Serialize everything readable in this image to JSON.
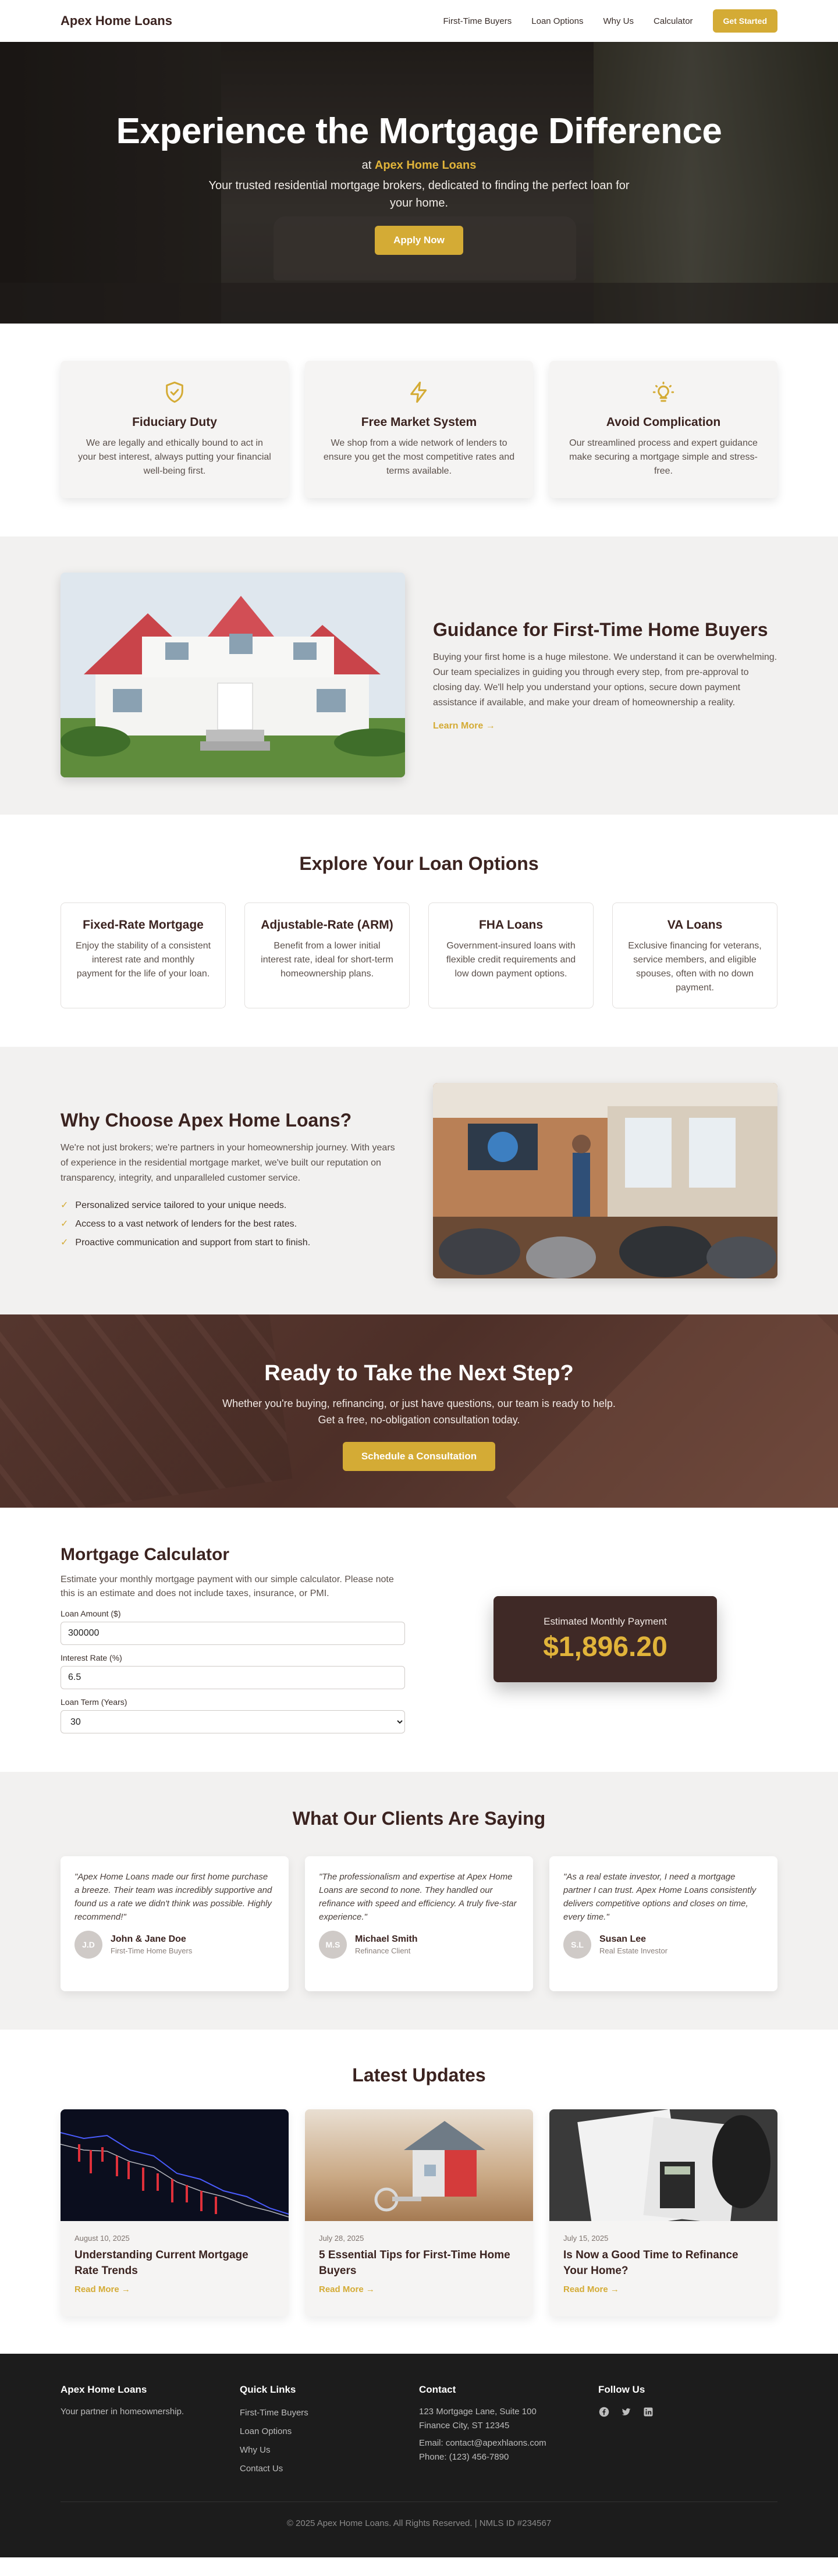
{
  "nav": {
    "brand": "Apex Home Loans",
    "links": [
      "First-Time Buyers",
      "Loan Options",
      "Why Us",
      "Calculator"
    ],
    "cta": "Get Started"
  },
  "hero": {
    "title": "Experience the Mortgage Difference",
    "at": "at",
    "brand": "Apex Home Loans",
    "subtitle": "Your trusted residential mortgage brokers, dedicated to finding the perfect loan for your home.",
    "cta": "Apply Now"
  },
  "features": [
    {
      "icon": "shield-check-icon",
      "title": "Fiduciary Duty",
      "text": "We are legally and ethically bound to act in your best interest, always putting your financial well-being first."
    },
    {
      "icon": "lightning-bolt-icon",
      "title": "Free Market System",
      "text": "We shop from a wide network of lenders to ensure you get the most competitive rates and terms available."
    },
    {
      "icon": "lightbulb-icon",
      "title": "Avoid Complication",
      "text": "Our streamlined process and expert guidance make securing a mortgage simple and stress-free."
    }
  ],
  "guidance": {
    "title": "Guidance for First-Time Home Buyers",
    "text": "Buying your first home is a huge milestone. We understand it can be overwhelming. Our team specializes in guiding you through every step, from pre-approval to closing day. We'll help you understand your options, secure down payment assistance if available, and make your dream of homeownership a reality.",
    "link": "Learn More →"
  },
  "loans": {
    "title": "Explore Your Loan Options",
    "items": [
      {
        "title": "Fixed-Rate Mortgage",
        "text": "Enjoy the stability of a consistent interest rate and monthly payment for the life of your loan."
      },
      {
        "title": "Adjustable-Rate (ARM)",
        "text": "Benefit from a lower initial interest rate, ideal for short-term homeownership plans."
      },
      {
        "title": "FHA Loans",
        "text": "Government-insured loans with flexible credit requirements and low down payment options."
      },
      {
        "title": "VA Loans",
        "text": "Exclusive financing for veterans, service members, and eligible spouses, often with no down payment."
      }
    ]
  },
  "why": {
    "title": "Why Choose Apex Home Loans?",
    "text": "We're not just brokers; we're partners in your homeownership journey. With years of experience in the residential mortgage market, we've built our reputation on transparency, integrity, and unparalleled customer service.",
    "points": [
      "Personalized service tailored to your unique needs.",
      "Access to a vast network of lenders for the best rates.",
      "Proactive communication and support from start to finish."
    ]
  },
  "cta": {
    "title": "Ready to Take the Next Step?",
    "text": "Whether you're buying, refinancing, or just have questions, our team is ready to help. Get a free, no-obligation consultation today.",
    "button": "Schedule a Consultation"
  },
  "calculator": {
    "title": "Mortgage Calculator",
    "desc": "Estimate your monthly mortgage payment with our simple calculator. Please note this is an estimate and does not include taxes, insurance, or PMI.",
    "amount_label": "Loan Amount ($)",
    "amount_value": "300000",
    "rate_label": "Interest Rate (%)",
    "rate_value": "6.5",
    "term_label": "Loan Term (Years)",
    "term_value": "30",
    "result_label": "Estimated Monthly Payment",
    "result_value": "$1,896.20"
  },
  "testimonials": {
    "title": "What Our Clients Are Saying",
    "items": [
      {
        "quote": "\"Apex Home Loans made our first home purchase a breeze. Their team was incredibly supportive and found us a rate we didn't think was possible. Highly recommend!\"",
        "initials": "J.D",
        "name": "John & Jane Doe",
        "role": "First-Time Home Buyers"
      },
      {
        "quote": "\"The professionalism and expertise at Apex Home Loans are second to none. They handled our refinance with speed and efficiency. A truly five-star experience.\"",
        "initials": "M.S",
        "name": "Michael Smith",
        "role": "Refinance Client"
      },
      {
        "quote": "\"As a real estate investor, I need a mortgage partner I can trust. Apex Home Loans consistently delivers competitive options and closes on time, every time.\"",
        "initials": "S.L",
        "name": "Susan Lee",
        "role": "Real Estate Investor"
      }
    ]
  },
  "blog": {
    "title": "Latest Updates",
    "posts": [
      {
        "date": "August 10, 2025",
        "title": "Understanding Current Mortgage Rate Trends",
        "link": "Read More →"
      },
      {
        "date": "July 28, 2025",
        "title": "5 Essential Tips for First-Time Home Buyers",
        "link": "Read More →"
      },
      {
        "date": "July 15, 2025",
        "title": "Is Now a Good Time to Refinance Your Home?",
        "link": "Read More →"
      }
    ]
  },
  "footer": {
    "brand": "Apex Home Loans",
    "tagline": "Your partner in homeownership.",
    "quick_title": "Quick Links",
    "quick_links": [
      "First-Time Buyers",
      "Loan Options",
      "Why Us",
      "Contact Us"
    ],
    "contact_title": "Contact",
    "address1": "123 Mortgage Lane, Suite 100",
    "address2": "Finance City, ST 12345",
    "email": "Email: contact@apexhlaons.com",
    "phone": "Phone: (123) 456-7890",
    "follow_title": "Follow Us",
    "social_icons": [
      "facebook-icon",
      "twitter-icon",
      "linkedin-icon"
    ],
    "copyright": "© 2025 Apex Home Loans. All Rights Reserved. | NMLS ID #234567"
  },
  "colors": {
    "accent_gold": "#d4ab35",
    "dark_brown": "#3b2320",
    "footer_bg": "#1c1c1c"
  }
}
